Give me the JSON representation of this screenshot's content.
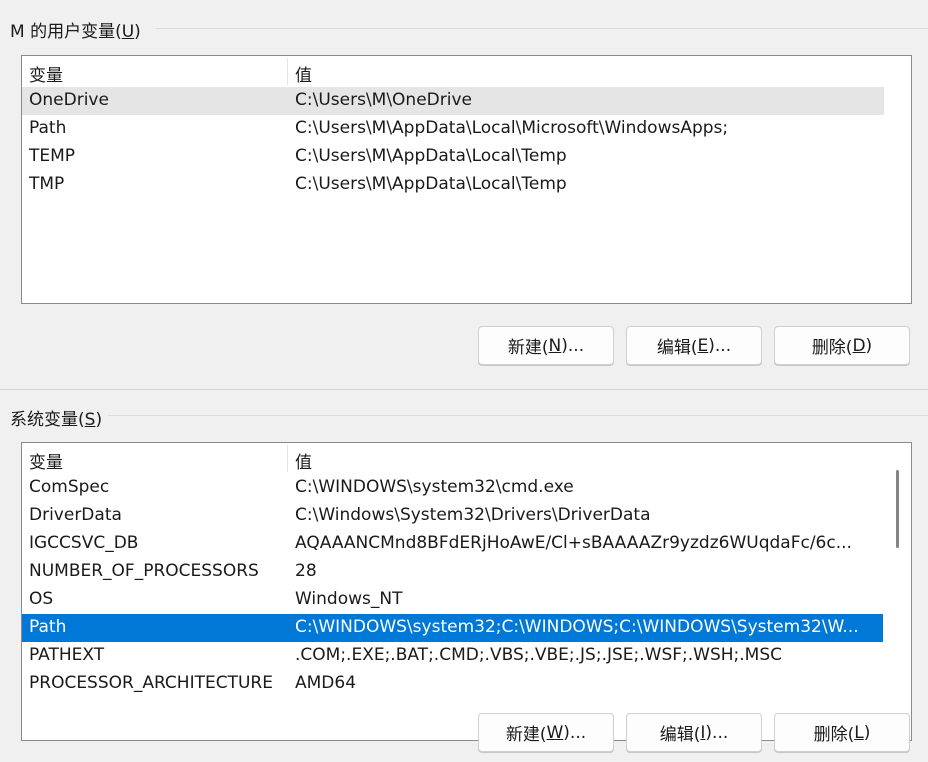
{
  "user_vars": {
    "title_prefix": "M 的用户变量(",
    "title_key": "U",
    "title_suffix": ")",
    "columns": {
      "name": "变量",
      "value": "值"
    },
    "rows": [
      {
        "name": "OneDrive",
        "value": "C:\\Users\\M\\OneDrive"
      },
      {
        "name": "Path",
        "value": "C:\\Users\\M\\AppData\\Local\\Microsoft\\WindowsApps;"
      },
      {
        "name": "TEMP",
        "value": "C:\\Users\\M\\AppData\\Local\\Temp"
      },
      {
        "name": "TMP",
        "value": "C:\\Users\\M\\AppData\\Local\\Temp"
      }
    ],
    "buttons": {
      "new_prefix": "新建(",
      "new_key": "N",
      "new_suffix": ")...",
      "edit_prefix": "编辑(",
      "edit_key": "E",
      "edit_suffix": ")...",
      "delete_prefix": "删除(",
      "delete_key": "D",
      "delete_suffix": ")"
    }
  },
  "system_vars": {
    "title_prefix": "系统变量(",
    "title_key": "S",
    "title_suffix": ")",
    "columns": {
      "name": "变量",
      "value": "值"
    },
    "rows": [
      {
        "name": "ComSpec",
        "value": "C:\\WINDOWS\\system32\\cmd.exe"
      },
      {
        "name": "DriverData",
        "value": "C:\\Windows\\System32\\Drivers\\DriverData"
      },
      {
        "name": "IGCCSVC_DB",
        "value": "AQAAANCMnd8BFdERjHoAwE/Cl+sBAAAAZr9yzdz6WUqdaFc/6c..."
      },
      {
        "name": "NUMBER_OF_PROCESSORS",
        "value": "28"
      },
      {
        "name": "OS",
        "value": "Windows_NT"
      },
      {
        "name": "Path",
        "value": "C:\\WINDOWS\\system32;C:\\WINDOWS;C:\\WINDOWS\\System32\\W..."
      },
      {
        "name": "PATHEXT",
        "value": ".COM;.EXE;.BAT;.CMD;.VBS;.VBE;.JS;.JSE;.WSF;.WSH;.MSC"
      },
      {
        "name": "PROCESSOR_ARCHITECTURE",
        "value": "AMD64"
      }
    ],
    "buttons": {
      "new_prefix": "新建(",
      "new_key": "W",
      "new_suffix": ")...",
      "edit_prefix": "编辑(",
      "edit_key": "I",
      "edit_suffix": ")...",
      "delete_prefix": "删除(",
      "delete_key": "L",
      "delete_suffix": ")"
    }
  },
  "colors": {
    "selection": "#0078d7",
    "hover": "#e5e5e5",
    "background": "#f0f0f0"
  }
}
